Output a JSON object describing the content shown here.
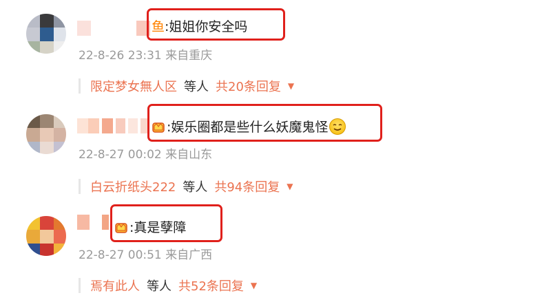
{
  "comments": [
    {
      "name_suffix": "鱼",
      "text": ":姐姐你安全吗",
      "meta": "22-8-26 23:31 来自重庆",
      "reply_user": "限定梦女無人区",
      "reply_mid": "等人",
      "reply_count": "共20条回复"
    },
    {
      "name_suffix": "",
      "text": ":娱乐圈都是些什么妖魔鬼怪",
      "meta": "22-8-27 00:02 来自山东",
      "reply_user": "白云折纸头222",
      "reply_mid": "等人",
      "reply_count": "共94条回复"
    },
    {
      "name_suffix": "",
      "text": ":真是孽障",
      "meta": "22-8-27 00:51 来自广西",
      "reply_user": "焉有此人",
      "reply_mid": "等人",
      "reply_count": "共52条回复"
    }
  ],
  "icons": {
    "crown": "crown-icon",
    "dizzy_face": "dizzy-smile-icon",
    "caret": "caret-down-icon"
  },
  "colors": {
    "highlight": "#e0201b",
    "reply_link": "#eb7350",
    "meta": "#9a9a9a"
  }
}
